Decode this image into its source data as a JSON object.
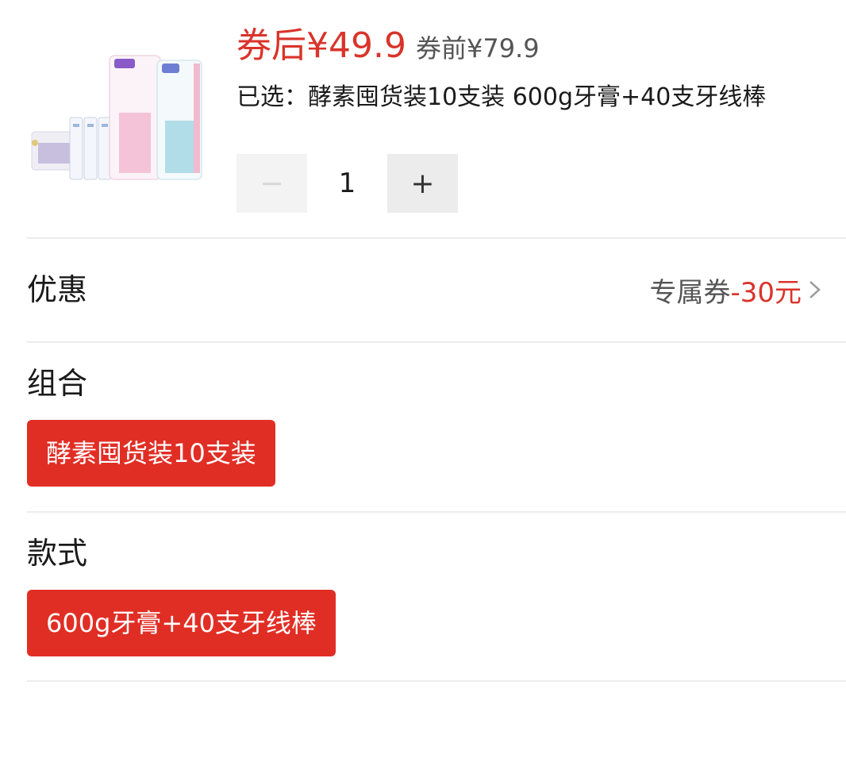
{
  "product": {
    "image_icon": "toothpaste-product-image",
    "price_after_coupon": "券后¥49.9",
    "price_before_coupon": "券前¥79.9",
    "selected_text": "已选：酵素囤货装10支装 600g牙膏+40支牙线棒"
  },
  "quantity": {
    "minus_label": "−",
    "value": "1",
    "plus_label": "+"
  },
  "discount": {
    "title": "优惠",
    "coupon_label": "专属券",
    "coupon_value": "-30元",
    "chevron_icon": "chevron-right-icon"
  },
  "combo": {
    "title": "组合",
    "options": [
      "酵素囤货装10支装"
    ],
    "selected": 0
  },
  "style": {
    "title": "款式",
    "options": [
      "600g牙膏+40支牙线棒"
    ],
    "selected": 0
  },
  "colors": {
    "accent_red": "#e12e25",
    "price_red": "#d9342b"
  }
}
